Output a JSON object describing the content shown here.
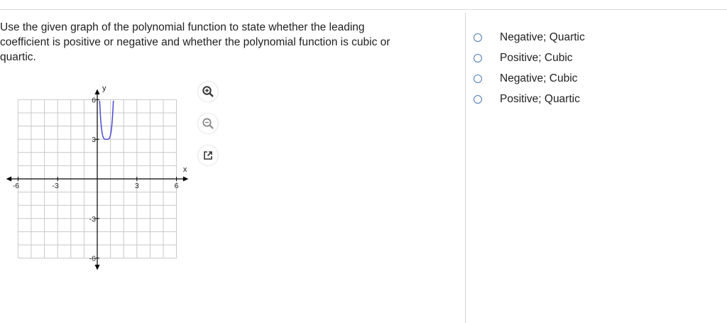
{
  "question": {
    "text": "Use the given graph of the polynomial function to state whether the leading\ncoefficient is positive or negative and  whether the polynomial function is cubic or\nquartic."
  },
  "graph": {
    "axis_x_label": "x",
    "axis_y_label": "y",
    "x_tick_labels": [
      "-6",
      "-3",
      "3",
      "6"
    ],
    "y_tick_labels": [
      "6",
      "3",
      "-3",
      "-6"
    ],
    "x_range": [
      -6,
      6
    ],
    "y_range": [
      -6,
      6
    ],
    "curve_color": "#4a4ad0",
    "axis_color": "#000000",
    "grid_color": "#c8c8c8"
  },
  "tools": {
    "zoom_in_icon": "zoom-in-icon",
    "zoom_out_icon": "zoom-out-icon",
    "popout_icon": "external-window-icon",
    "accent_color": "#4a79b8"
  },
  "answers": [
    {
      "label": "Negative; Quartic"
    },
    {
      "label": "Positive; Cubic"
    },
    {
      "label": "Negative; Cubic"
    },
    {
      "label": "Positive; Quartic"
    }
  ]
}
